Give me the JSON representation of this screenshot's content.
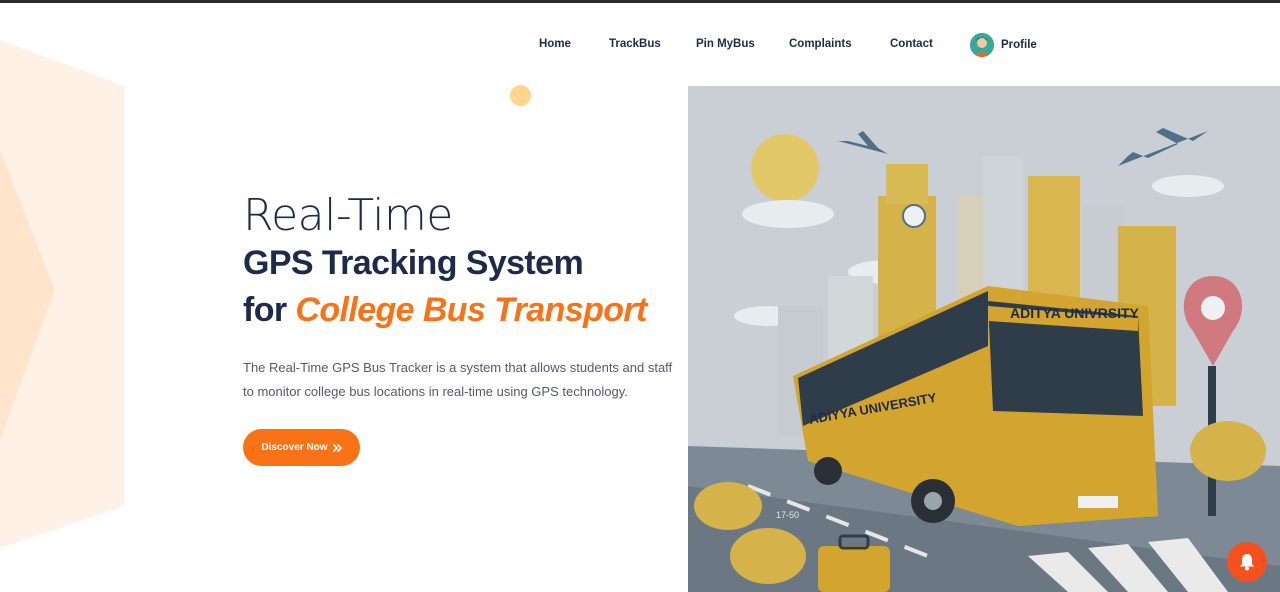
{
  "nav": {
    "items": [
      {
        "label": "Home"
      },
      {
        "label": "TrackBus"
      },
      {
        "label": "Pin MyBus"
      },
      {
        "label": "Complaints"
      },
      {
        "label": "Contact"
      }
    ],
    "profile_label": "Profile"
  },
  "hero": {
    "line1": "Real-Time",
    "line2": "GPS Tracking System",
    "line3_prefix": "for ",
    "line3_accent": "College Bus Transport",
    "description": "The Real-Time GPS Bus Tracker is a system that allows students and staff to monitor college bus locations in real-time using GPS technology.",
    "cta_label": "Discover Now",
    "cta_icon": "double-chevron-right-icon"
  },
  "illustration": {
    "bus_sign": "ADITYA UNIVRSITY",
    "bus_side": "ADIYYA UNIVERSITY",
    "road_marking": "17-50"
  },
  "colors": {
    "accent": "#f97316",
    "heading": "#1e2a4a",
    "bell": "#f4511e"
  }
}
